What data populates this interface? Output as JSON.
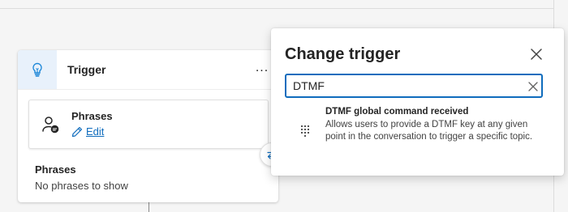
{
  "trigger": {
    "title": "Trigger",
    "more_label": "...",
    "phrases_card": {
      "title": "Phrases",
      "edit_label": "Edit"
    },
    "phrases_section": {
      "title": "Phrases",
      "empty_text": "No phrases to show"
    }
  },
  "change_trigger": {
    "title": "Change trigger",
    "search": {
      "value": "DTMF"
    },
    "results": [
      {
        "title": "DTMF global command received",
        "description": "Allows users to provide a DTMF key at any given point in the conversation to trigger a specific topic."
      }
    ]
  },
  "colors": {
    "accent": "#0f6cbd",
    "trigger_icon_bg": "#e8f1fb",
    "trigger_icon": "#1a86d8"
  },
  "icons": {
    "trigger": "lightbulb-icon",
    "phrases": "person-chat-icon",
    "edit": "pencil-icon",
    "swap": "swap-arrows-icon",
    "close": "close-icon",
    "clear": "clear-icon",
    "result": "dialpad-icon"
  }
}
